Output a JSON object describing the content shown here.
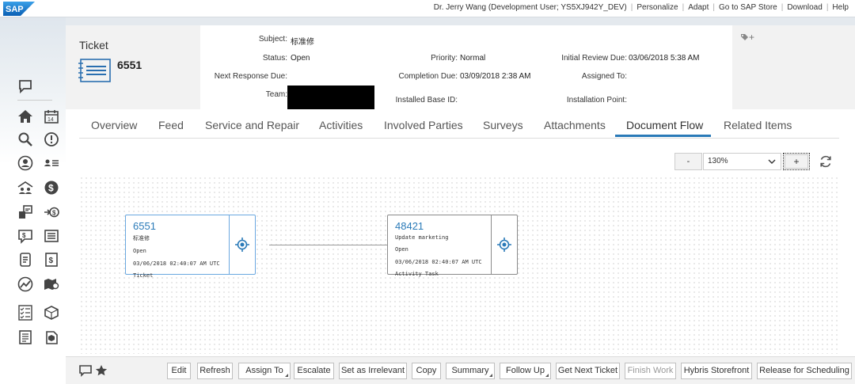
{
  "topbar": {
    "logo_text": "SAP",
    "user": "Dr. Jerry Wang (Development User; YS5XJ942Y_DEV)",
    "links": [
      "Personalize",
      "Adapt",
      "Go to SAP Store",
      "Download",
      "Help"
    ]
  },
  "header": {
    "object_type": "Ticket",
    "ticket_id": "6551",
    "fields": {
      "subject_label": "Subject:",
      "subject_value": "标准修",
      "status_label": "Status:",
      "status_value": "Open",
      "priority_label": "Priority:",
      "priority_value": "Normal",
      "initial_review_label": "Initial Review Due:",
      "initial_review_value": "03/06/2018 5:38 AM",
      "next_response_label": "Next Response Due:",
      "next_response_value": "",
      "completion_label": "Completion Due:",
      "completion_value": "03/09/2018 2:38 AM",
      "assigned_label": "Assigned To:",
      "assigned_value": "",
      "team_label": "Team:",
      "installed_base_label": "Installed Base ID:",
      "installation_point_label": "Installation Point:"
    },
    "tag_button": "+"
  },
  "tabs": [
    {
      "label": "Overview"
    },
    {
      "label": "Feed"
    },
    {
      "label": "Service and Repair"
    },
    {
      "label": "Activities"
    },
    {
      "label": "Involved Parties"
    },
    {
      "label": "Surveys"
    },
    {
      "label": "Attachments"
    },
    {
      "label": "Document Flow",
      "active": true
    },
    {
      "label": "Related Items"
    }
  ],
  "zoom": {
    "minus_label": "-",
    "value": "130%",
    "plus_label": "+"
  },
  "flow": {
    "nodes": [
      {
        "id": "6551",
        "description": "标准修",
        "status": "Open",
        "date": "03/06/2018 02:40:07 AM UTC",
        "type": "Ticket",
        "selected": true
      },
      {
        "id": "48421",
        "description": "Update marketing",
        "status": "Open",
        "date": "03/06/2018 02:40:07 AM UTC",
        "type": "Activity Task",
        "selected": false
      }
    ]
  },
  "footer": {
    "buttons": [
      {
        "label": "Edit"
      },
      {
        "label": "Refresh"
      },
      {
        "label": "Assign To",
        "menu": true
      },
      {
        "label": "Escalate"
      },
      {
        "label": "Set as Irrelevant"
      },
      {
        "label": "Copy"
      },
      {
        "label": "Summary",
        "menu": true
      },
      {
        "label": "Follow Up",
        "menu": true
      },
      {
        "label": "Get Next Ticket"
      },
      {
        "label": "Finish Work",
        "disabled": true
      },
      {
        "label": "Hybris Storefront"
      },
      {
        "label": "Release for Scheduling"
      }
    ]
  },
  "colors": {
    "accent": "#2a7ab8",
    "sap_blue": "#1a73c8",
    "header_bg": "#f2f2f2"
  }
}
